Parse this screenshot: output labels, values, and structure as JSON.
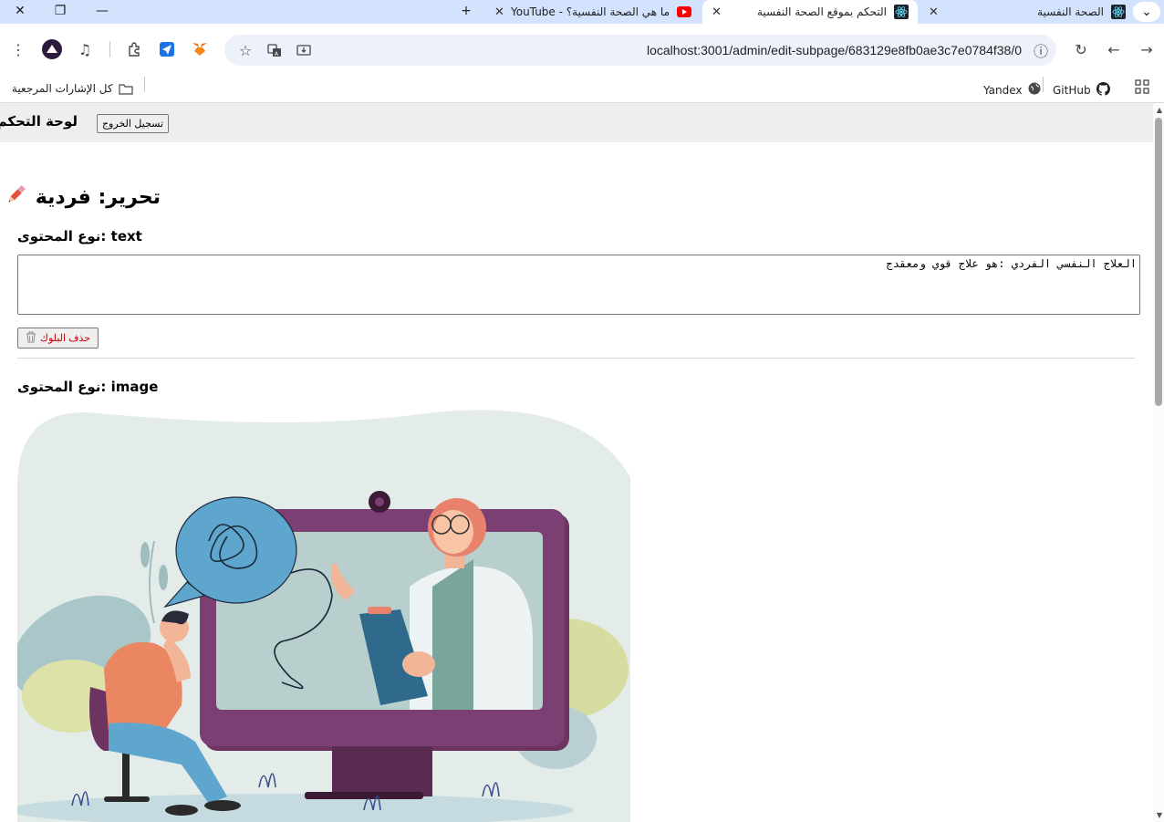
{
  "browser": {
    "tabs": [
      {
        "title": "الصحة النفسية",
        "active": false
      },
      {
        "title": "التحكم بموقع الصحة النفسية",
        "active": true
      },
      {
        "title": "ما هي الصحة النفسية؟ - YouTube",
        "active": false
      }
    ],
    "url": "localhost:3001/admin/edit-subpage/683129e8fb0ae3c7e0784f38/0",
    "bookmarks": {
      "all_bookmarks": "كل الإشارات المرجعية",
      "github": "GitHub",
      "yandex": "Yandex"
    }
  },
  "admin": {
    "title": "لوحة التحكم",
    "logout_label": "تسجيل الخروج"
  },
  "editor": {
    "title": "تحرير: فردية",
    "blocks": [
      {
        "type_label": "نوع المحتوى: text",
        "content": "العلاج النفسي الفردي :هو علاج قوي ومعقدج",
        "delete_label": "حذف البلوك"
      },
      {
        "type_label": "نوع المحتوى: image"
      }
    ]
  },
  "colors": {
    "chrome_bg": "#d3e3fd",
    "admin_bar": "#eeeeee",
    "danger": "#cc0000",
    "illus_bg": "#e4ecea",
    "monitor": "#7b3f73",
    "bubble": "#5fa6cf"
  }
}
